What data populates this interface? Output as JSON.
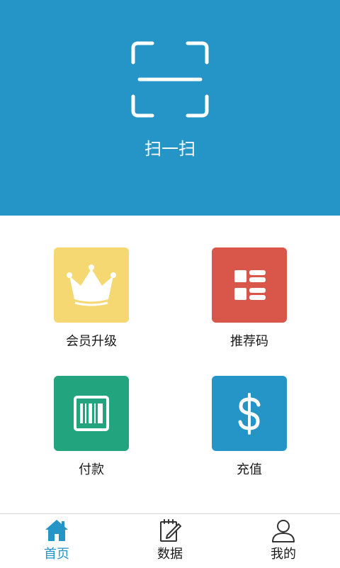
{
  "colors": {
    "hero_background": "#2595c8",
    "upgrade_tile": "#f5d872",
    "referral_tile": "#d9564a",
    "pay_tile": "#22a57e",
    "recharge_tile": "#2595c8",
    "active_tab": "#2595c8"
  },
  "scan": {
    "label": "扫一扫",
    "icon": "scan-frame-icon"
  },
  "tiles": [
    {
      "label": "会员升级",
      "icon": "crown-icon"
    },
    {
      "label": "推荐码",
      "icon": "grid-list-icon"
    },
    {
      "label": "付款",
      "icon": "barcode-icon"
    },
    {
      "label": "充值",
      "icon": "dollar-icon"
    }
  ],
  "tabbar": {
    "active": "首页",
    "items": [
      {
        "label": "首页",
        "icon": "home-icon"
      },
      {
        "label": "数据",
        "icon": "notepad-pencil-icon"
      },
      {
        "label": "我的",
        "icon": "user-icon"
      }
    ]
  }
}
